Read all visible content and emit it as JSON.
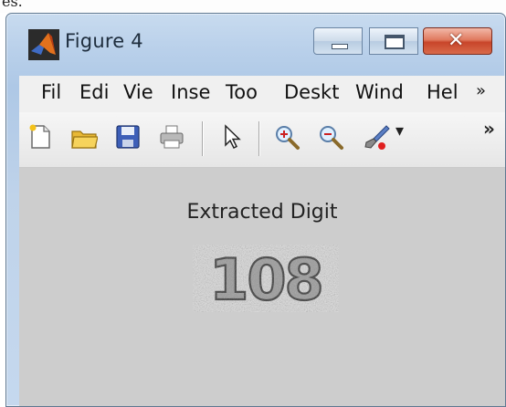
{
  "page_fragment": "es.",
  "window": {
    "title": "Figure 4",
    "buttons": [
      "minimize",
      "maximize",
      "close"
    ]
  },
  "menu": {
    "items": [
      "Fil",
      "Edi",
      "Vie",
      "Inse",
      "Too",
      "Deskt",
      "Wind",
      "Hel"
    ],
    "overflow_glyph": "»"
  },
  "toolbar": {
    "icons": [
      "new-figure-icon",
      "open-folder-icon",
      "save-icon",
      "print-icon",
      "pointer-icon",
      "zoom-in-icon",
      "zoom-out-icon",
      "brush-icon"
    ],
    "dropdown_glyph": "▾",
    "overflow_glyph": "»"
  },
  "figure": {
    "axes_title": "Extracted Digit",
    "image_text": "108"
  }
}
